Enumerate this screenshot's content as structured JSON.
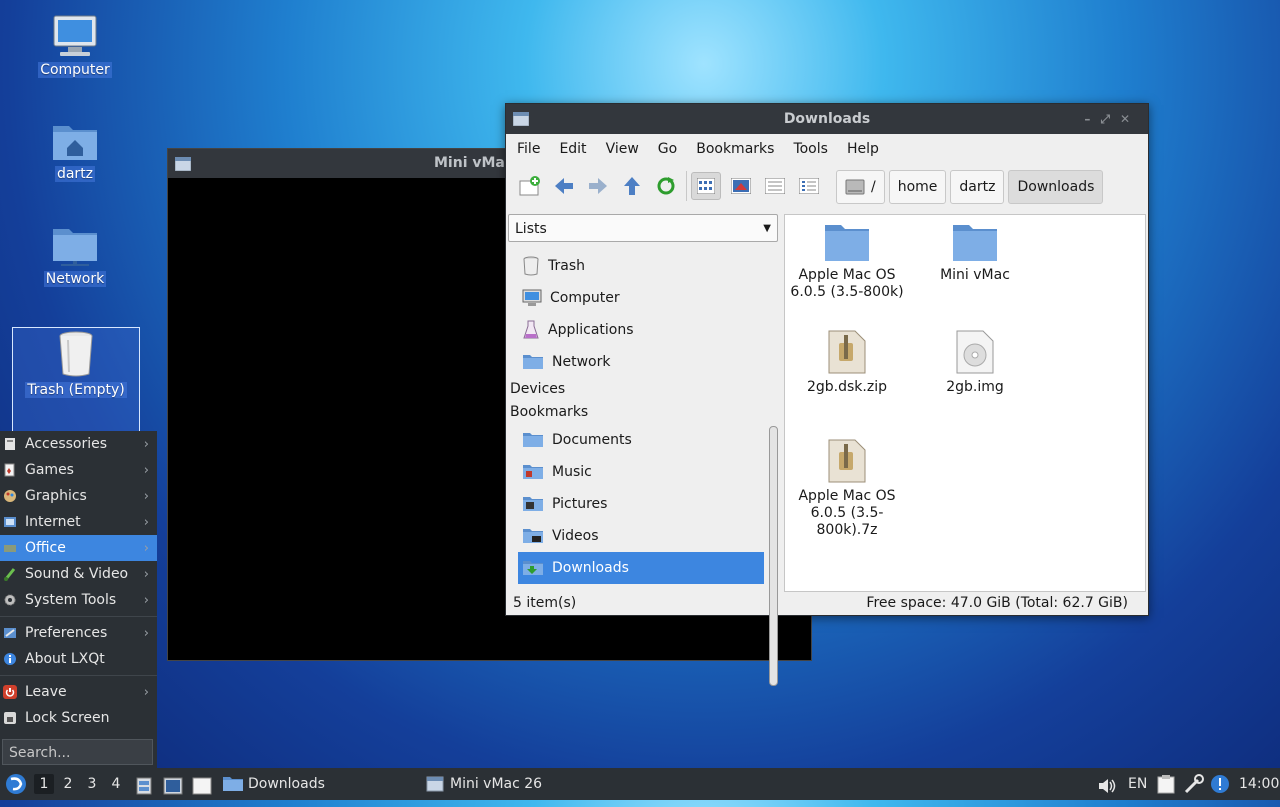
{
  "desktop": {
    "icons": [
      {
        "label": "Computer"
      },
      {
        "label": "dartz"
      },
      {
        "label": "Network"
      },
      {
        "label": "Trash (Empty)"
      }
    ]
  },
  "vmac_window": {
    "title": "Mini vMac"
  },
  "file_manager": {
    "title": "Downloads",
    "menus": [
      "File",
      "Edit",
      "View",
      "Go",
      "Bookmarks",
      "Tools",
      "Help"
    ],
    "path": [
      "/",
      "home",
      "dartz",
      "Downloads"
    ],
    "side_combo": "Lists",
    "places": [
      "Trash",
      "Computer",
      "Applications",
      "Network"
    ],
    "devices_header": "Devices",
    "bookmarks_header": "Bookmarks",
    "bookmarks": [
      "Documents",
      "Music",
      "Pictures",
      "Videos",
      "Downloads"
    ],
    "files": [
      {
        "name": "Apple Mac OS 6.0.5 (3.5-800k)",
        "type": "folder-icon"
      },
      {
        "name": "Mini vMac",
        "type": "folder-icon"
      },
      {
        "name": "2gb.dsk.zip",
        "type": "archive-icon"
      },
      {
        "name": "2gb.img",
        "type": "disk-image-icon"
      },
      {
        "name": "Apple Mac OS 6.0.5 (3.5-800k).7z",
        "type": "archive-icon"
      }
    ],
    "status_left": "5 item(s)",
    "status_right": "Free space: 47.0 GiB (Total: 62.7 GiB)"
  },
  "start_menu": {
    "items": [
      "Accessories",
      "Games",
      "Graphics",
      "Internet",
      "Office",
      "Sound & Video",
      "System Tools"
    ],
    "items2": [
      "Preferences",
      "About LXQt"
    ],
    "items3": [
      "Leave",
      "Lock Screen"
    ],
    "search_placeholder": "Search..."
  },
  "taskbar": {
    "workspaces": [
      "1",
      "2",
      "3",
      "4"
    ],
    "tasks": [
      "Downloads",
      "Mini vMac 26"
    ],
    "keyboard_layout": "EN",
    "clock": "14:00"
  },
  "colors": {
    "accent": "#3d86e0",
    "panel": "#2b3035"
  }
}
